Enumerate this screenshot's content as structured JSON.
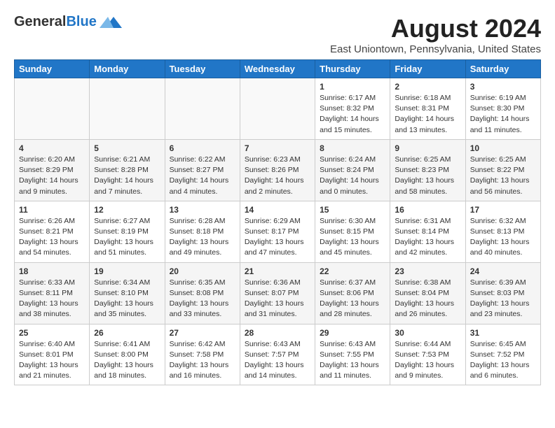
{
  "header": {
    "logo_general": "General",
    "logo_blue": "Blue",
    "month": "August 2024",
    "location": "East Uniontown, Pennsylvania, United States"
  },
  "days_of_week": [
    "Sunday",
    "Monday",
    "Tuesday",
    "Wednesday",
    "Thursday",
    "Friday",
    "Saturday"
  ],
  "weeks": [
    [
      {
        "day": "",
        "info": ""
      },
      {
        "day": "",
        "info": ""
      },
      {
        "day": "",
        "info": ""
      },
      {
        "day": "",
        "info": ""
      },
      {
        "day": "1",
        "info": "Sunrise: 6:17 AM\nSunset: 8:32 PM\nDaylight: 14 hours and 15 minutes."
      },
      {
        "day": "2",
        "info": "Sunrise: 6:18 AM\nSunset: 8:31 PM\nDaylight: 14 hours and 13 minutes."
      },
      {
        "day": "3",
        "info": "Sunrise: 6:19 AM\nSunset: 8:30 PM\nDaylight: 14 hours and 11 minutes."
      }
    ],
    [
      {
        "day": "4",
        "info": "Sunrise: 6:20 AM\nSunset: 8:29 PM\nDaylight: 14 hours and 9 minutes."
      },
      {
        "day": "5",
        "info": "Sunrise: 6:21 AM\nSunset: 8:28 PM\nDaylight: 14 hours and 7 minutes."
      },
      {
        "day": "6",
        "info": "Sunrise: 6:22 AM\nSunset: 8:27 PM\nDaylight: 14 hours and 4 minutes."
      },
      {
        "day": "7",
        "info": "Sunrise: 6:23 AM\nSunset: 8:26 PM\nDaylight: 14 hours and 2 minutes."
      },
      {
        "day": "8",
        "info": "Sunrise: 6:24 AM\nSunset: 8:24 PM\nDaylight: 14 hours and 0 minutes."
      },
      {
        "day": "9",
        "info": "Sunrise: 6:25 AM\nSunset: 8:23 PM\nDaylight: 13 hours and 58 minutes."
      },
      {
        "day": "10",
        "info": "Sunrise: 6:25 AM\nSunset: 8:22 PM\nDaylight: 13 hours and 56 minutes."
      }
    ],
    [
      {
        "day": "11",
        "info": "Sunrise: 6:26 AM\nSunset: 8:21 PM\nDaylight: 13 hours and 54 minutes."
      },
      {
        "day": "12",
        "info": "Sunrise: 6:27 AM\nSunset: 8:19 PM\nDaylight: 13 hours and 51 minutes."
      },
      {
        "day": "13",
        "info": "Sunrise: 6:28 AM\nSunset: 8:18 PM\nDaylight: 13 hours and 49 minutes."
      },
      {
        "day": "14",
        "info": "Sunrise: 6:29 AM\nSunset: 8:17 PM\nDaylight: 13 hours and 47 minutes."
      },
      {
        "day": "15",
        "info": "Sunrise: 6:30 AM\nSunset: 8:15 PM\nDaylight: 13 hours and 45 minutes."
      },
      {
        "day": "16",
        "info": "Sunrise: 6:31 AM\nSunset: 8:14 PM\nDaylight: 13 hours and 42 minutes."
      },
      {
        "day": "17",
        "info": "Sunrise: 6:32 AM\nSunset: 8:13 PM\nDaylight: 13 hours and 40 minutes."
      }
    ],
    [
      {
        "day": "18",
        "info": "Sunrise: 6:33 AM\nSunset: 8:11 PM\nDaylight: 13 hours and 38 minutes."
      },
      {
        "day": "19",
        "info": "Sunrise: 6:34 AM\nSunset: 8:10 PM\nDaylight: 13 hours and 35 minutes."
      },
      {
        "day": "20",
        "info": "Sunrise: 6:35 AM\nSunset: 8:08 PM\nDaylight: 13 hours and 33 minutes."
      },
      {
        "day": "21",
        "info": "Sunrise: 6:36 AM\nSunset: 8:07 PM\nDaylight: 13 hours and 31 minutes."
      },
      {
        "day": "22",
        "info": "Sunrise: 6:37 AM\nSunset: 8:06 PM\nDaylight: 13 hours and 28 minutes."
      },
      {
        "day": "23",
        "info": "Sunrise: 6:38 AM\nSunset: 8:04 PM\nDaylight: 13 hours and 26 minutes."
      },
      {
        "day": "24",
        "info": "Sunrise: 6:39 AM\nSunset: 8:03 PM\nDaylight: 13 hours and 23 minutes."
      }
    ],
    [
      {
        "day": "25",
        "info": "Sunrise: 6:40 AM\nSunset: 8:01 PM\nDaylight: 13 hours and 21 minutes."
      },
      {
        "day": "26",
        "info": "Sunrise: 6:41 AM\nSunset: 8:00 PM\nDaylight: 13 hours and 18 minutes."
      },
      {
        "day": "27",
        "info": "Sunrise: 6:42 AM\nSunset: 7:58 PM\nDaylight: 13 hours and 16 minutes."
      },
      {
        "day": "28",
        "info": "Sunrise: 6:43 AM\nSunset: 7:57 PM\nDaylight: 13 hours and 14 minutes."
      },
      {
        "day": "29",
        "info": "Sunrise: 6:43 AM\nSunset: 7:55 PM\nDaylight: 13 hours and 11 minutes."
      },
      {
        "day": "30",
        "info": "Sunrise: 6:44 AM\nSunset: 7:53 PM\nDaylight: 13 hours and 9 minutes."
      },
      {
        "day": "31",
        "info": "Sunrise: 6:45 AM\nSunset: 7:52 PM\nDaylight: 13 hours and 6 minutes."
      }
    ]
  ]
}
